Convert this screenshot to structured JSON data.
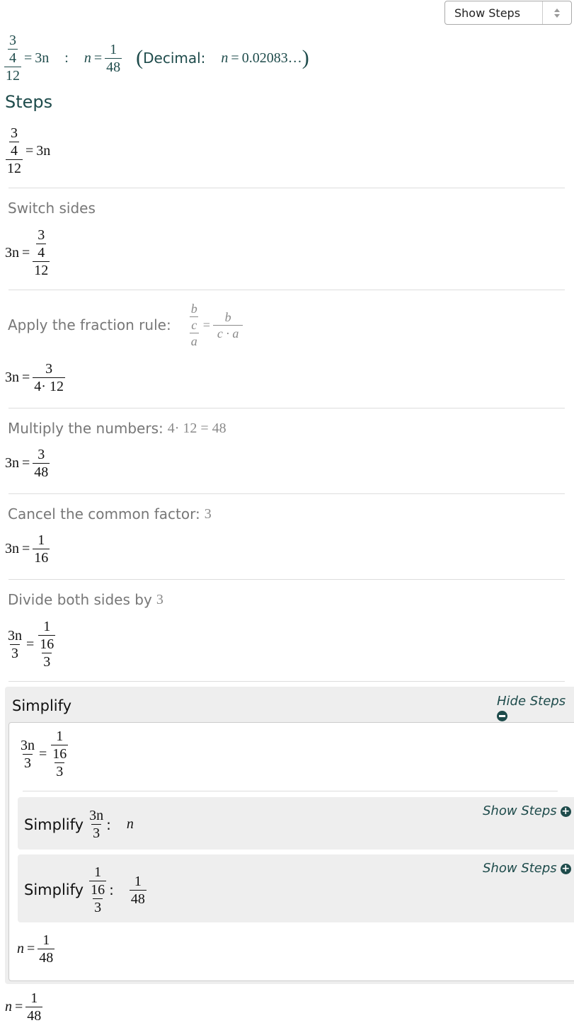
{
  "toolbar": {
    "select_value": "Show Steps"
  },
  "header": {
    "eq_num_top": "3",
    "eq_num_bot": "4",
    "eq_den": "12",
    "eq_rhs": "3n",
    "colon": ":",
    "sol_var": "n",
    "sol_num": "1",
    "sol_den": "48",
    "decimal_label": "Decimal:",
    "decimal_var": "n",
    "decimal_value": "0.02083…"
  },
  "steps_heading": "Steps",
  "steps": {
    "initial": {
      "num_top": "3",
      "num_bot": "4",
      "den": "12",
      "rhs": "3n"
    },
    "switch_sides": {
      "label": "Switch sides",
      "lhs": "3n",
      "num_top": "3",
      "num_bot": "4",
      "den": "12"
    },
    "fraction_rule": {
      "label": "Apply the fraction rule:",
      "rule_b": "b",
      "rule_c": "c",
      "rule_a": "a",
      "rule_rhs_num": "b",
      "rule_rhs_den": "c · a",
      "lhs": "3n",
      "num": "3",
      "den": "4· 12"
    },
    "multiply": {
      "label": "Multiply the numbers:",
      "expr": "4·  12 = 48",
      "lhs": "3n",
      "num": "3",
      "den": "48"
    },
    "cancel": {
      "label": "Cancel the common factor:",
      "factor": "3",
      "lhs": "3n",
      "num": "1",
      "den": "16"
    },
    "divide": {
      "label": "Divide both sides by",
      "divisor": "3",
      "lhs_num": "3n",
      "lhs_den": "3",
      "rhs_num": "1",
      "rhs_mid": "16",
      "rhs_den": "3"
    }
  },
  "simplify": {
    "title": "Simplify",
    "hide_steps": "Hide Steps",
    "eq": {
      "lhs_num": "3n",
      "lhs_den": "3",
      "rhs_num": "1",
      "rhs_mid": "16",
      "rhs_den": "3"
    },
    "sub1": {
      "label": "Simplify",
      "num": "3n",
      "den": "3",
      "result": "n",
      "show_steps": "Show Steps"
    },
    "sub2": {
      "label": "Simplify",
      "num": "1",
      "mid": "16",
      "den": "3",
      "result_num": "1",
      "result_den": "48",
      "show_steps": "Show Steps"
    },
    "result": {
      "var": "n",
      "num": "1",
      "den": "48"
    }
  },
  "final": {
    "var": "n",
    "num": "1",
    "den": "48"
  }
}
